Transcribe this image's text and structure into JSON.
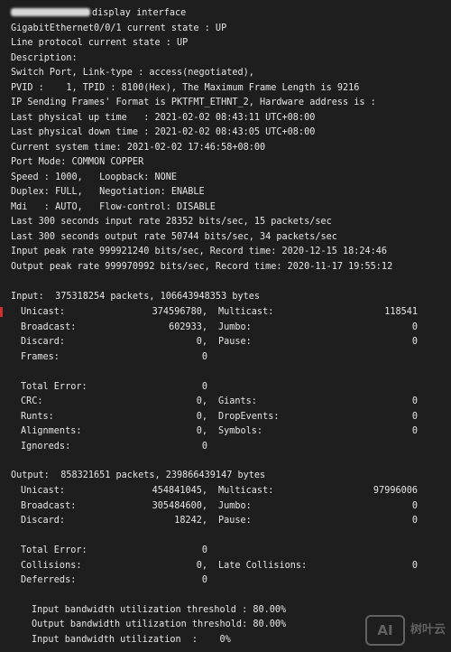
{
  "prompt": {
    "command": "display interface"
  },
  "header_lines": [
    "GigabitEthernet0/0/1 current state : UP",
    "Line protocol current state : UP",
    "Description:",
    "Switch Port, Link-type : access(negotiated),",
    "PVID :    1, TPID : 8100(Hex), The Maximum Frame Length is 9216",
    "IP Sending Frames' Format is PKTFMT_ETHNT_2, Hardware address is :",
    "Last physical up time   : 2021-02-02 08:43:11 UTC+08:00",
    "Last physical down time : 2021-02-02 08:43:05 UTC+08:00",
    "Current system time: 2021-02-02 17:46:58+08:00",
    "Port Mode: COMMON COPPER",
    "Speed : 1000,   Loopback: NONE",
    "Duplex: FULL,   Negotiation: ENABLE",
    "Mdi   : AUTO,   Flow-control: DISABLE",
    "Last 300 seconds input rate 28352 bits/sec, 15 packets/sec",
    "Last 300 seconds output rate 50744 bits/sec, 34 packets/sec",
    "Input peak rate 999921240 bits/sec, Record time: 2020-12-15 18:24:46",
    "Output peak rate 999970992 bits/sec, Record time: 2020-11-17 19:55:12"
  ],
  "input": {
    "summary": "Input:  375318254 packets, 106643948353 bytes",
    "rows": [
      {
        "l_label": "Unicast:",
        "l_value": "374596780,",
        "r_label": "Multicast:",
        "r_value": "118541"
      },
      {
        "l_label": "Broadcast:",
        "l_value": "602933,",
        "r_label": "Jumbo:",
        "r_value": "0"
      },
      {
        "l_label": "Discard:",
        "l_value": "0,",
        "r_label": "Pause:",
        "r_value": "0"
      },
      {
        "l_label": "Frames:",
        "l_value": "0",
        "r_label": "",
        "r_value": ""
      },
      {
        "l_label": "",
        "l_value": "",
        "r_label": "",
        "r_value": ""
      },
      {
        "l_label": "Total Error:",
        "l_value": "0",
        "r_label": "",
        "r_value": ""
      },
      {
        "l_label": "CRC:",
        "l_value": "0,",
        "r_label": "Giants:",
        "r_value": "0"
      },
      {
        "l_label": "Runts:",
        "l_value": "0,",
        "r_label": "DropEvents:",
        "r_value": "0"
      },
      {
        "l_label": "Alignments:",
        "l_value": "0,",
        "r_label": "Symbols:",
        "r_value": "0"
      },
      {
        "l_label": "Ignoreds:",
        "l_value": "0",
        "r_label": "",
        "r_value": ""
      }
    ]
  },
  "output": {
    "summary": "Output:  858321651 packets, 239866439147 bytes",
    "rows": [
      {
        "l_label": "Unicast:",
        "l_value": "454841045,",
        "r_label": "Multicast:",
        "r_value": "97996006"
      },
      {
        "l_label": "Broadcast:",
        "l_value": "305484600,",
        "r_label": "Jumbo:",
        "r_value": "0"
      },
      {
        "l_label": "Discard:",
        "l_value": "18242,",
        "r_label": "Pause:",
        "r_value": "0"
      },
      {
        "l_label": "",
        "l_value": "",
        "r_label": "",
        "r_value": ""
      },
      {
        "l_label": "Total Error:",
        "l_value": "0",
        "r_label": "",
        "r_value": ""
      },
      {
        "l_label": "Collisions:",
        "l_value": "0,",
        "r_label": "Late Collisions:",
        "r_value": "0"
      },
      {
        "l_label": "Deferreds:",
        "l_value": "0",
        "r_label": "",
        "r_value": ""
      }
    ]
  },
  "footer_lines": [
    "Input bandwidth utilization threshold : 80.00%",
    "Output bandwidth utilization threshold: 80.00%",
    "Input bandwidth utilization  :    0%"
  ],
  "watermark": {
    "badge": "AI",
    "text": "树叶云"
  },
  "colors": {
    "background": "#1e1e1e",
    "text": "#e6e6e6",
    "marker": "#d03030"
  }
}
